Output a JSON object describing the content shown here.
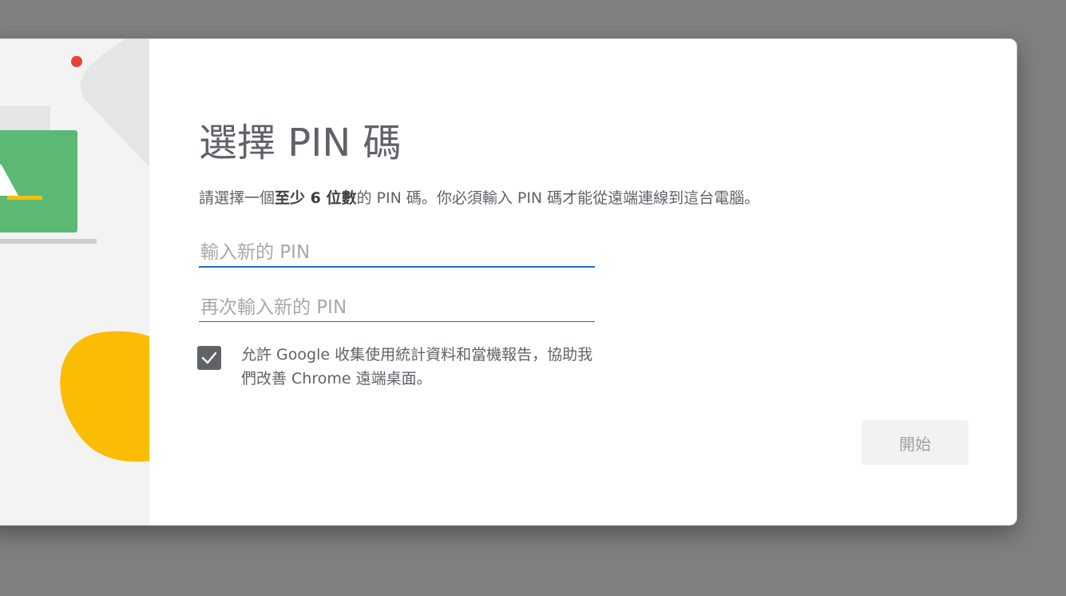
{
  "dialog": {
    "title": "選擇 PIN 碼",
    "description": {
      "before": "請選擇一個",
      "bold": "至少 6 位數",
      "after": "的 PIN 碼。你必須輸入 PIN 碼才能從遠端連線到這台電腦。"
    },
    "pin_input": {
      "placeholder": "輸入新的 PIN",
      "value": ""
    },
    "pin_confirm_input": {
      "placeholder": "再次輸入新的 PIN",
      "value": ""
    },
    "consent_checkbox": {
      "checked": true,
      "label": "允許 Google 收集使用統計資料和當機報告，協助我們改善 Chrome 遠端桌面。"
    },
    "start_button_label": "開始"
  },
  "colors": {
    "illustration_green": "#5bb974",
    "illustration_yellow": "#fbbc04",
    "illustration_red": "#ea4335",
    "input_focus_blue": "#1a73c8",
    "checkbox_gray": "#5f6368"
  }
}
